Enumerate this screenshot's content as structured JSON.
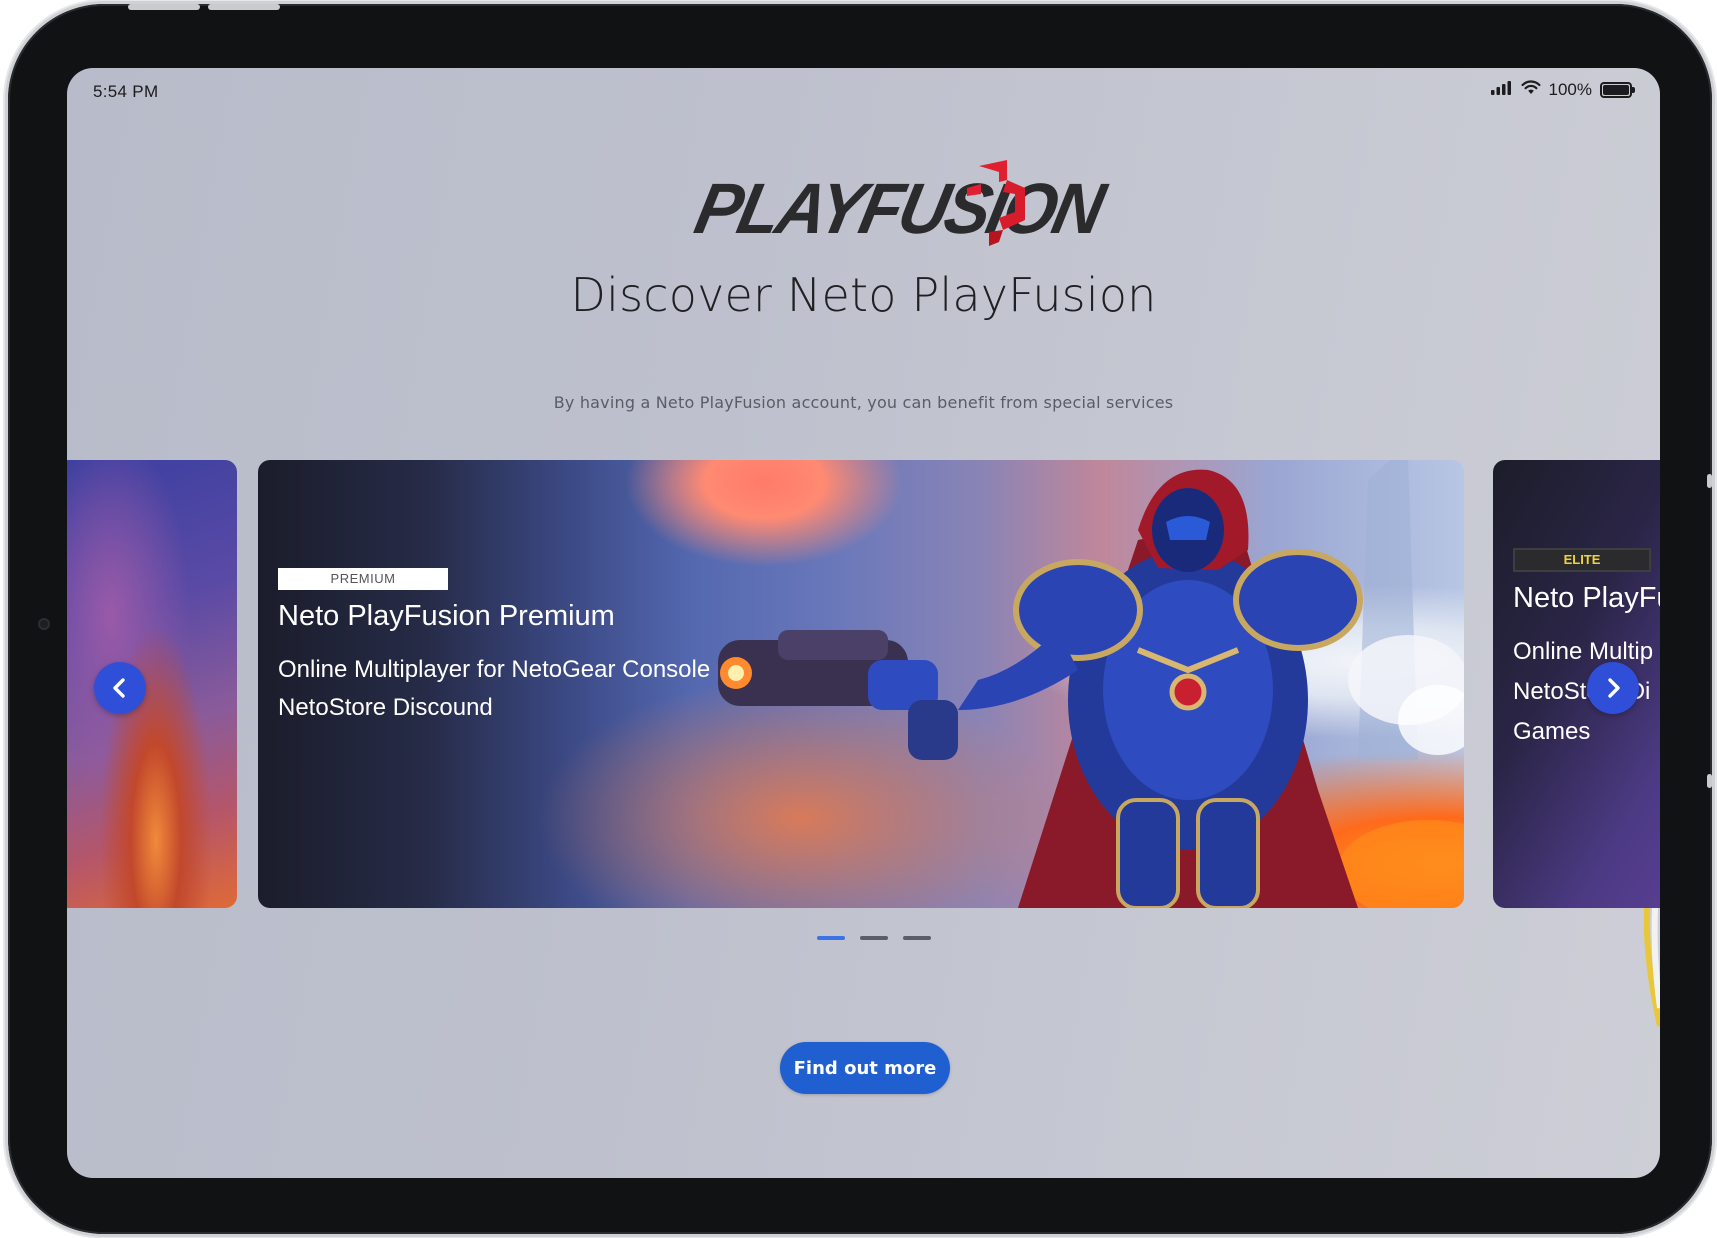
{
  "status_bar": {
    "time": "5:54 PM",
    "battery_percent": "100%",
    "icons": [
      "cellular-signal-icon",
      "wifi-icon",
      "battery-icon"
    ]
  },
  "brand": {
    "logo_text": "PLAYFUSION",
    "logo_colors": {
      "text": "#2b2b2d",
      "mark": "#e02030"
    }
  },
  "hero": {
    "title": "Discover Neto PlayFusion",
    "subtitle": "By having a Neto PlayFusion account, you can benefit from special services"
  },
  "carousel": {
    "active_index": 0,
    "cards": [
      {
        "badge": "PREMIUM",
        "title": "Neto PlayFusion Premium",
        "lines": [
          "Online Multiplayer for NetoGear Console",
          "NetoStore Discound"
        ]
      },
      {
        "badge": "ELITE",
        "title": "Neto PlayFu",
        "lines": [
          "Online Multip",
          "NetoStore Di",
          "Games"
        ]
      }
    ],
    "dot_count": 3,
    "prev_icon": "chevron-left-icon",
    "next_icon": "chevron-right-icon",
    "accent_color": "#2f4fd8"
  },
  "cta": {
    "label": "Find out more",
    "color": "#1f5fd0"
  }
}
